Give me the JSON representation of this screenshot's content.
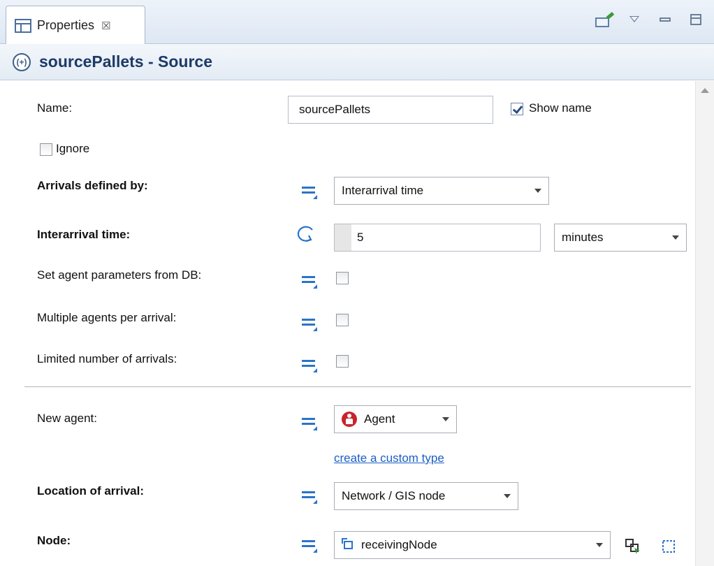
{
  "tab": {
    "title": "Properties",
    "close_glyph": "☒"
  },
  "view_actions": [
    {
      "name": "pin-editor-icon"
    },
    {
      "name": "view-menu-icon"
    },
    {
      "name": "minimize-icon"
    },
    {
      "name": "maximize-icon"
    }
  ],
  "header": {
    "icon": "source-icon",
    "icon_glyph": "(+)",
    "title": "sourcePallets - Source"
  },
  "form": {
    "name_label": "Name:",
    "name_value": "sourcePallets",
    "show_name_label": "Show name",
    "show_name_checked": true,
    "ignore_label": "Ignore",
    "ignore_checked": false,
    "arrivals_label": "Arrivals defined by:",
    "arrivals_value": "Interarrival time",
    "interarrival_label": "Interarrival time:",
    "interarrival_value": "5",
    "interarrival_unit": "minutes",
    "db_label": "Set agent parameters from DB:",
    "db_checked": false,
    "multiple_label": "Multiple agents per arrival:",
    "multiple_checked": false,
    "limited_label": "Limited number of arrivals:",
    "limited_checked": false,
    "new_agent_label": "New agent:",
    "new_agent_value": "Agent",
    "custom_type_link": "create a custom type",
    "location_label": "Location of arrival:",
    "location_value": "Network / GIS node",
    "node_label": "Node:",
    "node_value": "receivingNode"
  },
  "colors": {
    "accent_blue": "#2b74c9",
    "header_title": "#1d3a66",
    "agent_red": "#c8242c",
    "link": "#1a5fc5"
  }
}
